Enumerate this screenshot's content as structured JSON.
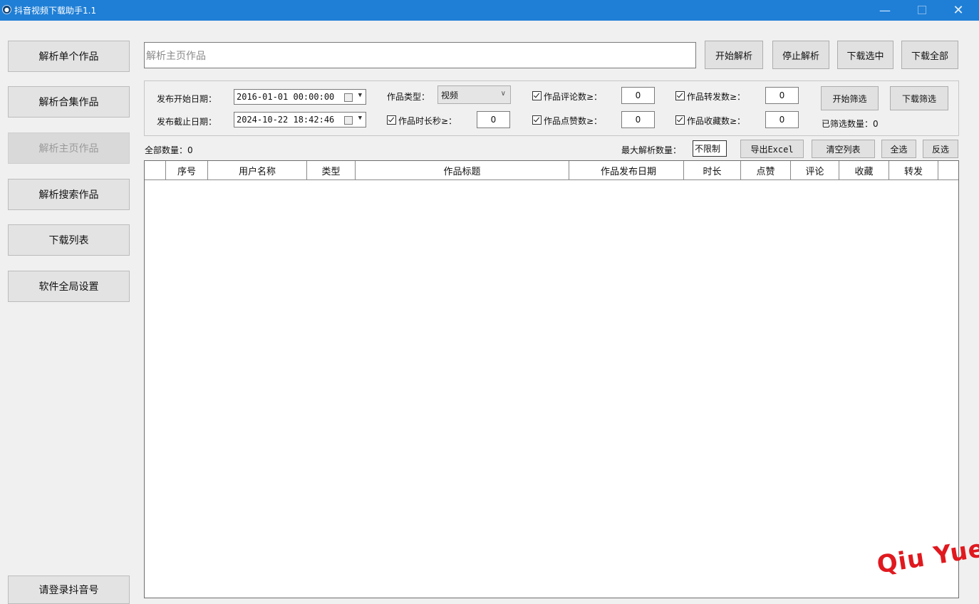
{
  "window": {
    "title": "抖音视频下载助手1.1",
    "minimize": "—",
    "close": "✕"
  },
  "sidebar": {
    "items": [
      {
        "label": "解析单个作品"
      },
      {
        "label": "解析合集作品"
      },
      {
        "label": "解析主页作品"
      },
      {
        "label": "解析搜索作品"
      },
      {
        "label": "下载列表"
      },
      {
        "label": "软件全局设置"
      }
    ],
    "login_label": "请登录抖音号"
  },
  "url_bar": {
    "placeholder": "解析主页作品",
    "value": ""
  },
  "actions": {
    "start_parse": "开始解析",
    "stop_parse": "停止解析",
    "download_selected": "下载选中",
    "download_all": "下载全部"
  },
  "filters": {
    "start_date_label": "发布开始日期：",
    "start_date_value": "2016-01-01 00:00:00",
    "end_date_label": "发布截止日期：",
    "end_date_value": "2024-10-22 18:42:46",
    "type_label": "作品类型：",
    "type_value": "视频",
    "duration_label": "作品时长秒≥：",
    "duration_value": "0",
    "comments_label": "作品评论数≥：",
    "comments_value": "0",
    "likes_label": "作品点赞数≥：",
    "likes_value": "0",
    "shares_label": "作品转发数≥：",
    "shares_value": "0",
    "favorites_label": "作品收藏数≥：",
    "favorites_value": "0",
    "start_filter": "开始筛选",
    "download_filter": "下载筛选",
    "filtered_count": "已筛选数量：0"
  },
  "toolbar": {
    "total_count": "全部数量：0",
    "max_parse_label": "最大解析数量：",
    "max_parse_value": "不限制",
    "export_excel": "导出Excel",
    "clear_list": "清空列表",
    "select_all": "全选",
    "invert_select": "反选"
  },
  "table": {
    "columns": [
      "序号",
      "用户名称",
      "类型",
      "作品标题",
      "作品发布日期",
      "时长",
      "点赞",
      "评论",
      "收藏",
      "转发"
    ],
    "rows": []
  },
  "watermark": "Qiu Yue",
  "colors": {
    "titlebar": "#1f7fd6",
    "window_bg": "#f0f0f0",
    "watermark": "#e0191f"
  }
}
